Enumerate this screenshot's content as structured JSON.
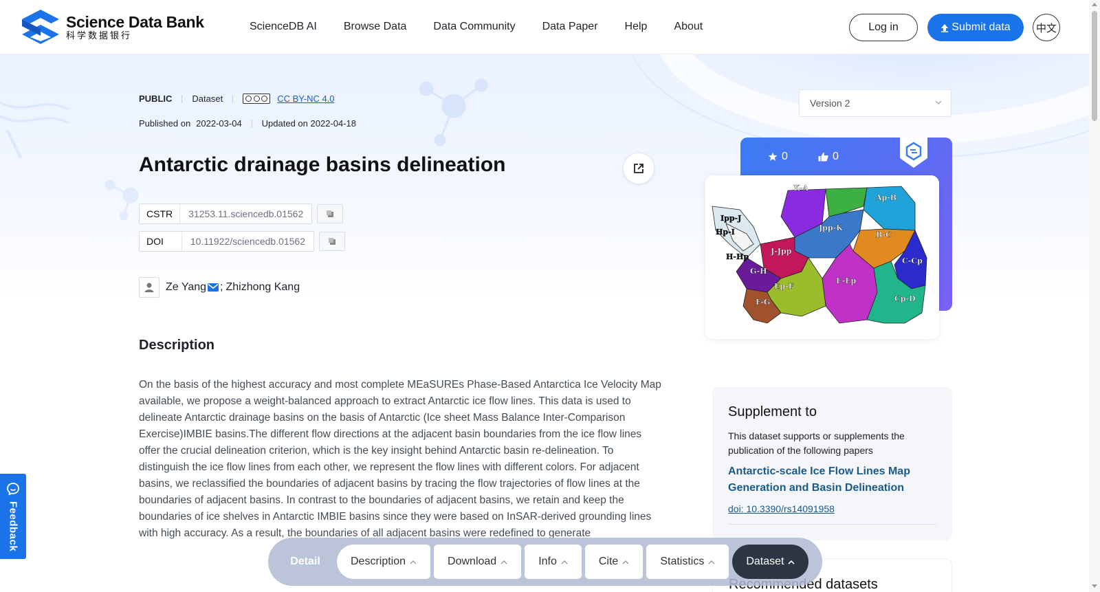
{
  "header": {
    "logo_title": "Science Data Bank",
    "logo_subtitle": "科学数据银行",
    "nav": [
      "ScienceDB AI",
      "Browse Data",
      "Data Community",
      "Data Paper",
      "Help",
      "About"
    ],
    "login": "Log in",
    "submit": "Submit data",
    "lang": "中文",
    "accent": "#1a73e8"
  },
  "meta": {
    "visibility": "PUBLIC",
    "type": "Dataset",
    "license": "CC BY-NC 4.0",
    "published_label": "Published on",
    "published_date": "2022-03-04",
    "updated": "Updated on 2022-04-18"
  },
  "dataset": {
    "title": "Antarctic drainage basins delineation",
    "cstr_label": "CSTR",
    "cstr_value": "31253.11.sciencedb.01562",
    "doi_label": "DOI",
    "doi_value": "10.11922/sciencedb.01562",
    "author1": "Ze Yang",
    "author_sep": ";",
    "author2": "Zhizhong Kang"
  },
  "description": {
    "heading": "Description",
    "text": "On the basis of the highest accuracy and most complete MEaSUREs Phase-Based Antarctica Ice Velocity Map available, we propose a weight-balanced approach to extract Antarctic ice flow lines. This data is used to delineate Antarctic drainage basins on the basis of Antarctic (Ice sheet Mass Balance Inter-Comparison Exercise)IMBIE basins.The different flow directions at the adjacent basin boundaries from the ice flow lines offer the crucial delineation criterion, which is the key insight behind Antarctic basin re-delineation. To distinguish the ice flow lines from each other, we represent the flow lines with different colors. For adjacent basins, we reclassified the boundaries of adjacent basins by tracing the flow trajectories of flow lines at the boundaries of adjacent basins. In contrast to the boundaries of adjacent basins, we retain and keep the boundaries of ice shelves in Antarctic IMBIE basins since they were based on InSAR-derived grounding lines with high accuracy. As a result, the boundaries of all adjacent basins were redefined to generate"
  },
  "sidebar": {
    "version": "Version 2",
    "stars": "0",
    "likes": "0",
    "map_labels": [
      "K-A",
      "Ap-B",
      "Ipp-J",
      "Hp-I",
      "Jpp-K",
      "B-C",
      "J-Jpp",
      "H-Hp",
      "C-Cp",
      "G-H",
      "E-Ep",
      "Ep-F",
      "F-G",
      "Cp-D"
    ],
    "supplement_heading": "Supplement to",
    "supplement_text": "This dataset supports or supplements the publication of the following papers",
    "paper_title": "Antarctic-scale Ice Flow Lines Map Generation and Basin Delineation",
    "paper_doi": "doi: 10.3390/rs14091958",
    "recommended_heading": "Recommended datasets"
  },
  "feedback": "Feedback",
  "bottom_bar": {
    "detail": "Detail",
    "tabs": [
      "Description",
      "Download",
      "Info",
      "Cite",
      "Statistics"
    ],
    "active": "Dataset"
  }
}
